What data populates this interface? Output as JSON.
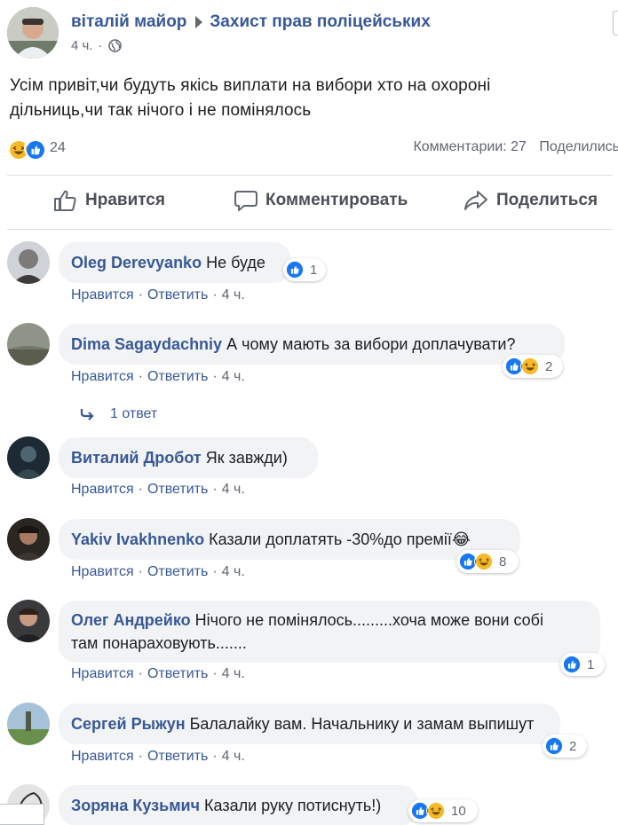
{
  "post": {
    "author": "віталій майор",
    "group": "Захист прав поліцейських",
    "time": "4 ч.",
    "dot": "·",
    "text_line1": "Усім привіт,чи будуть якісь виплати на вибори хто на охороні",
    "text_line2": "дільниць,чи так нічого і не помінялось",
    "reaction_count": "24",
    "comments_count": "Комментарии: 27",
    "shares_label": "Поделились"
  },
  "actions": {
    "like": "Нравится",
    "comment": "Комментировать",
    "share": "Поделиться"
  },
  "colors": {
    "link": "#385898",
    "like_blue": "#1877f2",
    "haha_yellow": "#f7b928",
    "bubble": "#f2f3f5"
  },
  "comment_links": {
    "like": "Нравится",
    "reply": "Ответить",
    "sep": "·",
    "time": "4 ч."
  },
  "comments": [
    {
      "name": "Oleg Derevyanko",
      "text": "Не буде",
      "reactions": [
        "like"
      ],
      "count": "1"
    },
    {
      "name": "Dima Sagaydachniy",
      "text": "А чому мають за вибори доплачувати?",
      "reactions": [
        "like",
        "haha"
      ],
      "count": "2"
    },
    {
      "name": "Виталий Дробот",
      "text": "Як завжди)",
      "reactions": [],
      "count": ""
    },
    {
      "name": "Yakiv Ivakhnenko",
      "text": "Казали доплатять -30%до премії😂",
      "reactions": [
        "like",
        "haha"
      ],
      "count": "8"
    },
    {
      "name": "Олег Андрейко",
      "text": "Нічого не помінялось.........хоча може вони собі",
      "text2": "там понараховують.......",
      "reactions": [
        "like"
      ],
      "count": "1"
    },
    {
      "name": "Сергей Рыжун",
      "text": "Балалайку вам. Начальнику и замам выпишут",
      "reactions": [
        "like"
      ],
      "count": "2"
    },
    {
      "name": "Зоряна Кузьмич",
      "text": "Казали руку потиснуть!)",
      "reactions": [
        "like",
        "haha"
      ],
      "count": "10"
    }
  ],
  "replies": {
    "label": "1 ответ"
  }
}
